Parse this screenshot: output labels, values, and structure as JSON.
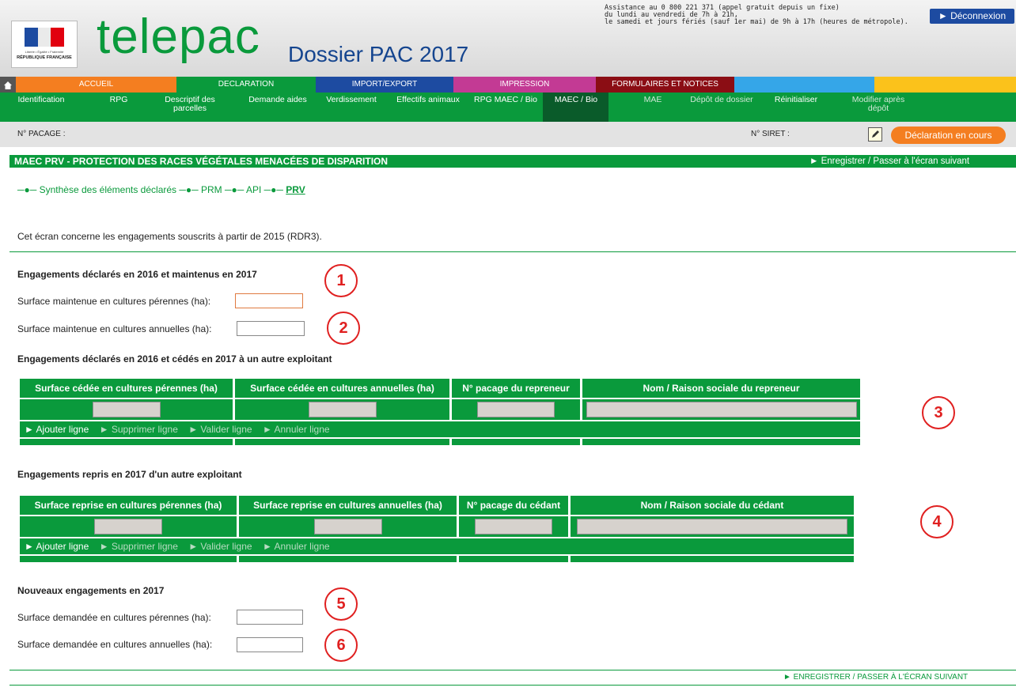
{
  "header": {
    "logo_text": "telepac",
    "dossier_title": "Dossier PAC 2017",
    "republique_text": "RÉPUBLIQUE FRANÇAISE",
    "republique_motto": "Liberté • Égalité • Fraternité",
    "assistance_lines": [
      "Assistance au 0 800 221 371 (appel gratuit depuis un fixe)",
      "du lundi au vendredi de 7h à 21h,",
      "le samedi et jours fériés (sauf 1er mai) de 9h à 17h (heures de métropole)."
    ],
    "logout_label": "► Déconnexion"
  },
  "main_nav": [
    {
      "label": "ACCUEIL",
      "color": "#f47e20"
    },
    {
      "label": "DECLARATION",
      "color": "#0a9a3c"
    },
    {
      "label": "IMPORT/EXPORT",
      "color": "#1d4ba1"
    },
    {
      "label": "IMPRESSION",
      "color": "#c33a94"
    },
    {
      "label": "FORMULAIRES ET NOTICES",
      "color": "#8b0d14"
    },
    {
      "label": "",
      "color": "#35a6e8"
    },
    {
      "label": "",
      "color": "#fbc21b"
    }
  ],
  "sub_nav": [
    "Identification",
    "RPG",
    "Descriptif des parcelles",
    "Demande aides",
    "Verdissement",
    "Effectifs animaux",
    "RPG MAEC / Bio",
    "MAEC / Bio",
    "MAE",
    "Dépôt de dossier",
    "Réinitialiser",
    "Modifier après dépôt"
  ],
  "info_bar": {
    "pacage_label": "N° PACAGE : ",
    "siret_label": "N° SIRET :",
    "status_label": "Déclaration en cours"
  },
  "section": {
    "title": "MAEC PRV - PROTECTION DES RACES VÉGÉTALES MENACÉES DE DISPARITION",
    "save_next": "► Enregistrer / Passer à l'écran suivant",
    "breadcrumb": [
      "Synthèse des éléments déclarés",
      "PRM",
      "API",
      "PRV"
    ],
    "intro": "Cet écran concerne les engagements souscrits à partir de 2015 (RDR3)."
  },
  "maintained": {
    "heading": "Engagements déclarés en 2016 et maintenus en 2017",
    "perennial_label": "Surface maintenue en cultures pérennes (ha):",
    "annual_label": "Surface maintenue en cultures annuelles (ha):"
  },
  "ceded": {
    "heading": "Engagements déclarés en 2016 et cédés en 2017 à un autre exploitant",
    "columns": [
      "Surface cédée en cultures pérennes (ha)",
      "Surface cédée en cultures annuelles (ha)",
      "N° pacage du repreneur",
      "Nom / Raison sociale du repreneur"
    ]
  },
  "taken": {
    "heading": "Engagements repris en 2017 d'un autre exploitant",
    "columns": [
      "Surface reprise en cultures pérennes (ha)",
      "Surface reprise en cultures annuelles (ha)",
      "N° pacage du cédant",
      "Nom / Raison sociale du cédant"
    ]
  },
  "row_actions": [
    "► Ajouter ligne",
    "► Supprimer ligne",
    "► Valider ligne",
    "► Annuler ligne"
  ],
  "new_commitments": {
    "heading": "Nouveaux engagements en 2017",
    "perennial_label": "Surface demandée en cultures pérennes (ha):",
    "annual_label": "Surface demandée en cultures annuelles (ha):"
  },
  "footer_save": "► ENREGISTRER / PASSER À L'ÉCRAN SUIVANT",
  "markers": [
    "1",
    "2",
    "3",
    "4",
    "5",
    "6"
  ]
}
